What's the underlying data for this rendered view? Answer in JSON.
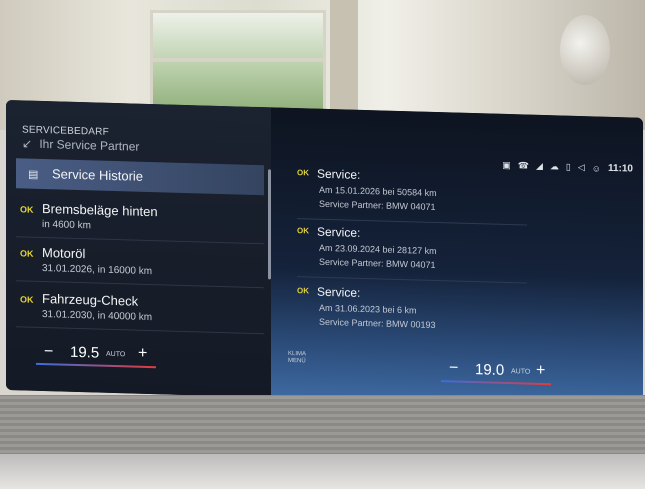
{
  "left_panel": {
    "header": "SERVICEBEDARF",
    "subheader": "Ihr Service Partner",
    "items": [
      {
        "label": "Service Historie",
        "status": "",
        "sub": ""
      },
      {
        "label": "Bremsbeläge hinten",
        "status": "OK",
        "sub": "in 4600 km"
      },
      {
        "label": "Motoröl",
        "status": "OK",
        "sub": "31.01.2026, in 16000 km"
      },
      {
        "label": "Fahrzeug-Check",
        "status": "OK",
        "sub": "31.01.2030, in 40000 km"
      }
    ],
    "climate": {
      "minus": "−",
      "temp": "19.5",
      "mode": "AUTO",
      "plus": "+"
    }
  },
  "right_panel": {
    "status_time": "11:10",
    "entries": [
      {
        "status": "OK",
        "title": "Service:",
        "line1": "Am 15.01.2026 bei 50584 km",
        "line2": "Service Partner: BMW 04071"
      },
      {
        "status": "OK",
        "title": "Service:",
        "line1": "Am 23.09.2024 bei 28127 km",
        "line2": "Service Partner: BMW 04071"
      },
      {
        "status": "OK",
        "title": "Service:",
        "line1": "Am 31.06.2023 bei 6 km",
        "line2": "Service Partner: BMW 00193"
      }
    ],
    "klima_label": "KLIMA",
    "menu_label": "MENÜ",
    "climate": {
      "minus": "−",
      "temp": "19.0",
      "mode": "AUTO",
      "plus": "+"
    }
  },
  "colors": {
    "ok": "#e1d23a",
    "highlight": "#4a5d85"
  }
}
